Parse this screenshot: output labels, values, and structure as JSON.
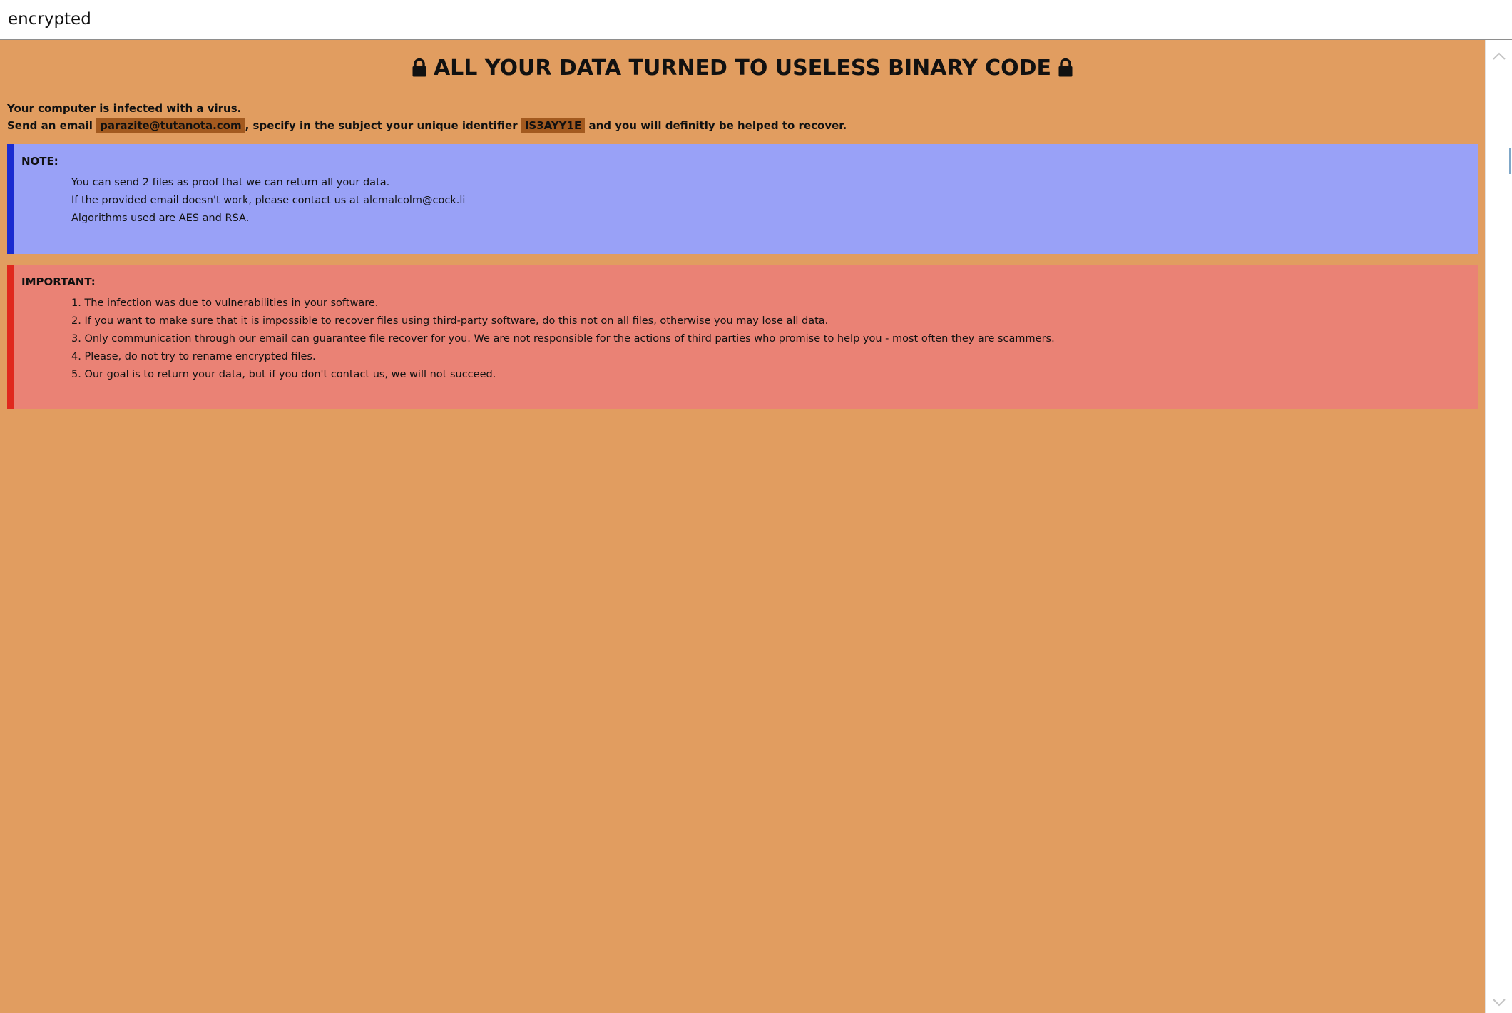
{
  "window": {
    "title": "encrypted"
  },
  "heading": {
    "text": "ALL YOUR DATA TURNED TO USELESS BINARY CODE",
    "icon": "lock-icon"
  },
  "intro": {
    "line1": "Your computer is infected with a virus.",
    "line2_prefix": "Send an email ",
    "email": "parazite@tutanota.com",
    "line2_middle": ", specify in the subject your unique identifier ",
    "identifier": "IS3AYY1E",
    "line2_suffix": " and you will definitly be helped to recover."
  },
  "note": {
    "title": "NOTE:",
    "lines": [
      "You can send 2 files as proof that we can return all your data.",
      "If the provided email doesn't work, please contact us at alcmalcolm@cock.li",
      "Algorithms used are AES and RSA."
    ]
  },
  "important": {
    "title": "IMPORTANT:",
    "items": [
      "1. The infection was due to vulnerabilities in your software.",
      "2. If you want to make sure that it is impossible to recover files using third-party software, do this not on all files, otherwise you may lose all data.",
      "3. Only communication through our email can guarantee file recover for you. We are not responsible for the actions of third parties who promise to help you - most often they are scammers.",
      "4. Please, do not try to rename encrypted files.",
      "5. Our goal is to return your data, but if you don't contact us, we will not succeed."
    ]
  },
  "colors": {
    "page_background": "#e19d60",
    "highlight": "#a35a1f",
    "note_background": "#99a1f7",
    "note_border": "#1a2bd0",
    "important_background": "#ea8275",
    "important_border": "#e0281d"
  }
}
